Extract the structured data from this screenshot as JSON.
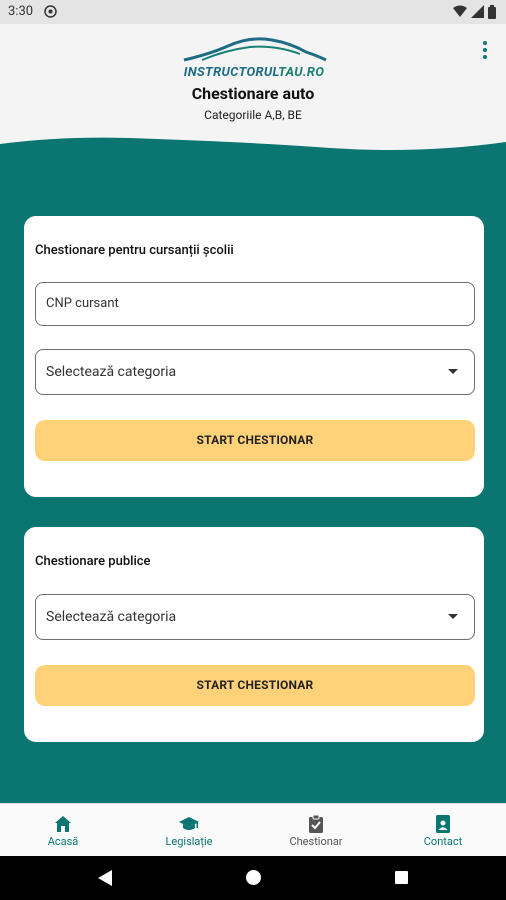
{
  "status_bar": {
    "time": "3:30",
    "app_icon": "at-sign-icon",
    "right_icons": [
      "wifi-icon",
      "signal-icon",
      "battery-icon"
    ]
  },
  "header": {
    "logo": {
      "part1": "INSTRUCTORUL",
      "part2": "TAU.RO"
    },
    "title": "Chestionare auto",
    "subtitle": "Categoriile A,B, BE",
    "menu_icon": "more-vert-icon"
  },
  "colors": {
    "teal": "#0a7571",
    "button_yellow": "#ffd27a",
    "logo_blue": "#1d6c86",
    "logo_green": "#187f73"
  },
  "school_quiz": {
    "title": "Chestionare pentru cursanții școlii",
    "cnp_placeholder": "CNP cursant",
    "category_select": "Selectează categoria",
    "start_label": "START CHESTIONAR"
  },
  "public_quiz": {
    "title": "Chestionare publice",
    "category_select": "Selectează categoria",
    "start_label": "START CHESTIONAR"
  },
  "bottom_nav": {
    "items": [
      {
        "label": "Acasă",
        "icon": "home-icon",
        "active": true
      },
      {
        "label": "Legislație",
        "icon": "graduation-cap-icon",
        "active": false
      },
      {
        "label": "Chestionar",
        "icon": "checklist-icon",
        "active": false
      },
      {
        "label": "Contact",
        "icon": "contact-card-icon",
        "active": true
      }
    ]
  }
}
